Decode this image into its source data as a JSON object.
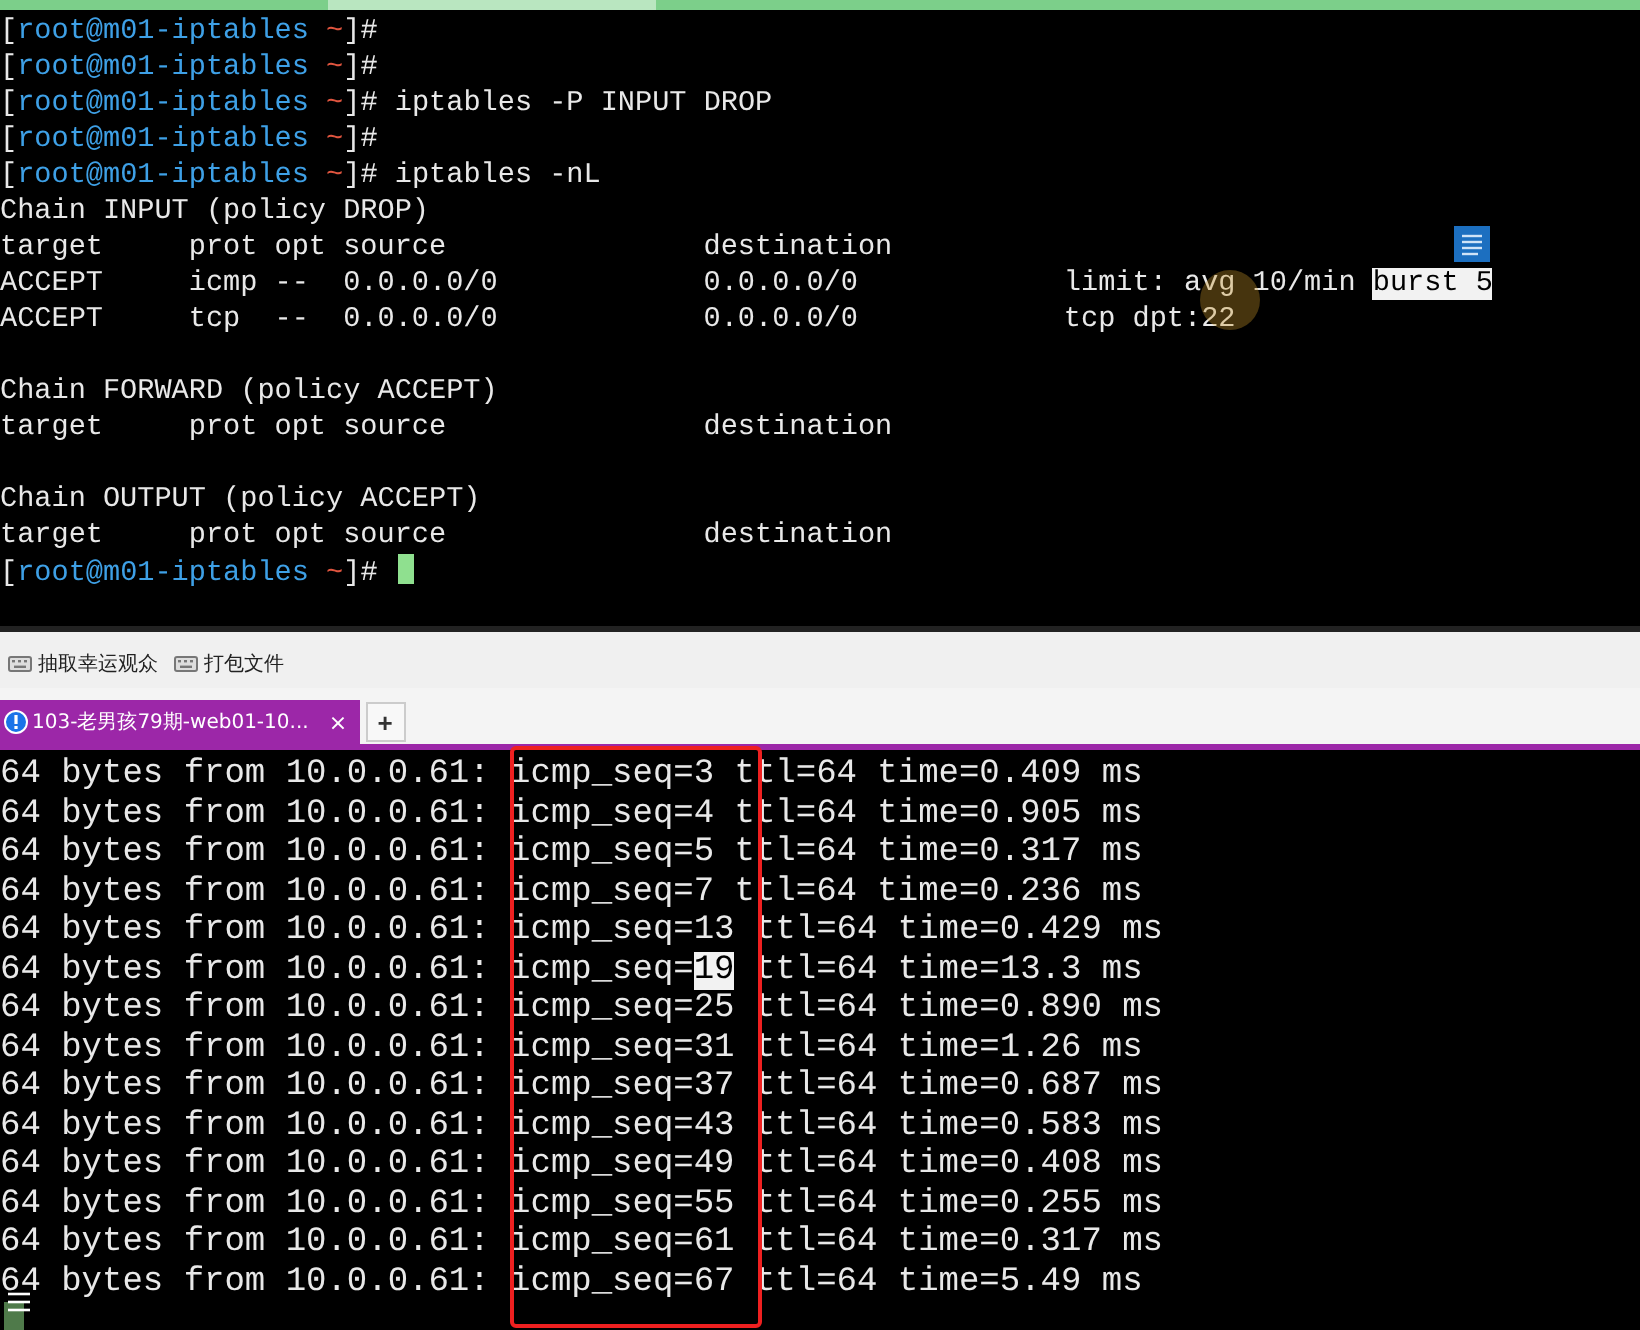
{
  "top_terminal": {
    "lines": [
      {
        "kind": "prompt",
        "open": "[",
        "user": "root@m01-iptables",
        "cwd": "~",
        "close": "]#",
        "cursor": false
      },
      {
        "kind": "prompt",
        "open": "[",
        "user": "root@m01-iptables",
        "cwd": "~",
        "close": "]#",
        "cursor": false
      },
      {
        "kind": "prompt",
        "open": "[",
        "user": "root@m01-iptables",
        "cwd": "~",
        "close": "]#",
        "command": " iptables -P INPUT DROP",
        "cursor": false
      },
      {
        "kind": "prompt",
        "open": "[",
        "user": "root@m01-iptables",
        "cwd": "~",
        "close": "]#",
        "cursor": false
      },
      {
        "kind": "prompt",
        "open": "[",
        "user": "root@m01-iptables",
        "cwd": "~",
        "close": "]#",
        "command": " iptables -nL",
        "cursor": false
      },
      {
        "kind": "output",
        "segments": [
          {
            "text": "Chain INPUT (policy DROP)",
            "highlighted": false
          }
        ]
      },
      {
        "kind": "output",
        "segments": [
          {
            "text": "target     prot opt source               destination",
            "highlighted": false
          }
        ]
      },
      {
        "kind": "output",
        "segments": [
          {
            "text": "ACCEPT     icmp --  0.0.0.0/0            0.0.0.0/0            limit: avg 10/min ",
            "highlighted": false
          },
          {
            "text": "burst 5",
            "highlighted": true
          }
        ]
      },
      {
        "kind": "output",
        "segments": [
          {
            "text": "ACCEPT     tcp  --  0.0.0.0/0            0.0.0.0/0            tcp dpt:22",
            "highlighted": false
          }
        ]
      },
      {
        "kind": "blank"
      },
      {
        "kind": "output",
        "segments": [
          {
            "text": "Chain FORWARD (policy ACCEPT)",
            "highlighted": false
          }
        ]
      },
      {
        "kind": "output",
        "segments": [
          {
            "text": "target     prot opt source               destination",
            "highlighted": false
          }
        ]
      },
      {
        "kind": "blank"
      },
      {
        "kind": "output",
        "segments": [
          {
            "text": "Chain OUTPUT (policy ACCEPT)",
            "highlighted": false
          }
        ]
      },
      {
        "kind": "output",
        "segments": [
          {
            "text": "target     prot opt source               destination",
            "highlighted": false
          }
        ]
      },
      {
        "kind": "prompt",
        "open": "[",
        "user": "root@m01-iptables",
        "cwd": "~",
        "close": "]#",
        "cursor": true
      }
    ]
  },
  "toolbar": {
    "buttons": [
      {
        "label": "抽取幸运观众"
      },
      {
        "label": "打包文件"
      }
    ]
  },
  "tabs": [
    {
      "label": "103-老男孩79期-web01-10...",
      "selected": true,
      "close": "×"
    }
  ],
  "new_tab": "+",
  "bottom_terminal": {
    "lines": [
      {
        "kind": "output",
        "segments": [
          {
            "text": "64 bytes from 10.0.0.61: icmp_seq=",
            "highlighted": false
          },
          {
            "text": "3",
            "highlighted": false
          },
          {
            "text": " ttl=64 time=0.409 ms",
            "highlighted": false
          }
        ]
      },
      {
        "kind": "output",
        "segments": [
          {
            "text": "64 bytes from 10.0.0.61: icmp_seq=",
            "highlighted": false
          },
          {
            "text": "4",
            "highlighted": false
          },
          {
            "text": " ttl=64 time=0.905 ms",
            "highlighted": false
          }
        ]
      },
      {
        "kind": "output",
        "segments": [
          {
            "text": "64 bytes from 10.0.0.61: icmp_seq=",
            "highlighted": false
          },
          {
            "text": "5",
            "highlighted": false
          },
          {
            "text": " ttl=64 time=0.317 ms",
            "highlighted": false
          }
        ]
      },
      {
        "kind": "output",
        "segments": [
          {
            "text": "64 bytes from 10.0.0.61: icmp_seq=",
            "highlighted": false
          },
          {
            "text": "7",
            "highlighted": false
          },
          {
            "text": " ttl=64 time=0.236 ms",
            "highlighted": false
          }
        ]
      },
      {
        "kind": "output",
        "segments": [
          {
            "text": "64 bytes from 10.0.0.61: icmp_seq=",
            "highlighted": false
          },
          {
            "text": "13",
            "highlighted": false
          },
          {
            "text": " ttl=64 time=0.429 ms",
            "highlighted": false
          }
        ]
      },
      {
        "kind": "output",
        "segments": [
          {
            "text": "64 bytes from 10.0.0.61: icmp_seq=",
            "highlighted": false
          },
          {
            "text": "19",
            "highlighted": true
          },
          {
            "text": " ttl=64 time=13.3 ms",
            "highlighted": false
          }
        ]
      },
      {
        "kind": "output",
        "segments": [
          {
            "text": "64 bytes from 10.0.0.61: icmp_seq=",
            "highlighted": false
          },
          {
            "text": "25",
            "highlighted": false
          },
          {
            "text": " ttl=64 time=0.890 ms",
            "highlighted": false
          }
        ]
      },
      {
        "kind": "output",
        "segments": [
          {
            "text": "64 bytes from 10.0.0.61: icmp_seq=",
            "highlighted": false
          },
          {
            "text": "31",
            "highlighted": false
          },
          {
            "text": " ttl=64 time=1.26 ms",
            "highlighted": false
          }
        ]
      },
      {
        "kind": "output",
        "segments": [
          {
            "text": "64 bytes from 10.0.0.61: icmp_seq=",
            "highlighted": false
          },
          {
            "text": "37",
            "highlighted": false
          },
          {
            "text": " ttl=64 time=0.687 ms",
            "highlighted": false
          }
        ]
      },
      {
        "kind": "output",
        "segments": [
          {
            "text": "64 bytes from 10.0.0.61: icmp_seq=",
            "highlighted": false
          },
          {
            "text": "43",
            "highlighted": false
          },
          {
            "text": " ttl=64 time=0.583 ms",
            "highlighted": false
          }
        ]
      },
      {
        "kind": "output",
        "segments": [
          {
            "text": "64 bytes from 10.0.0.61: icmp_seq=",
            "highlighted": false
          },
          {
            "text": "49",
            "highlighted": false
          },
          {
            "text": " ttl=64 time=0.408 ms",
            "highlighted": false
          }
        ]
      },
      {
        "kind": "output",
        "segments": [
          {
            "text": "64 bytes from 10.0.0.61: icmp_seq=",
            "highlighted": false
          },
          {
            "text": "55",
            "highlighted": false
          },
          {
            "text": " ttl=64 time=0.255 ms",
            "highlighted": false
          }
        ]
      },
      {
        "kind": "output",
        "segments": [
          {
            "text": "64 bytes from 10.0.0.61: icmp_seq=",
            "highlighted": false
          },
          {
            "text": "61",
            "highlighted": false
          },
          {
            "text": " ttl=64 time=0.317 ms",
            "highlighted": false
          }
        ]
      },
      {
        "kind": "output",
        "segments": [
          {
            "text": "64 bytes from 10.0.0.61: icmp_seq=",
            "highlighted": false
          },
          {
            "text": "67",
            "highlighted": false
          },
          {
            "text": " ttl=64 time=5.49 ms",
            "highlighted": false
          }
        ]
      }
    ]
  }
}
